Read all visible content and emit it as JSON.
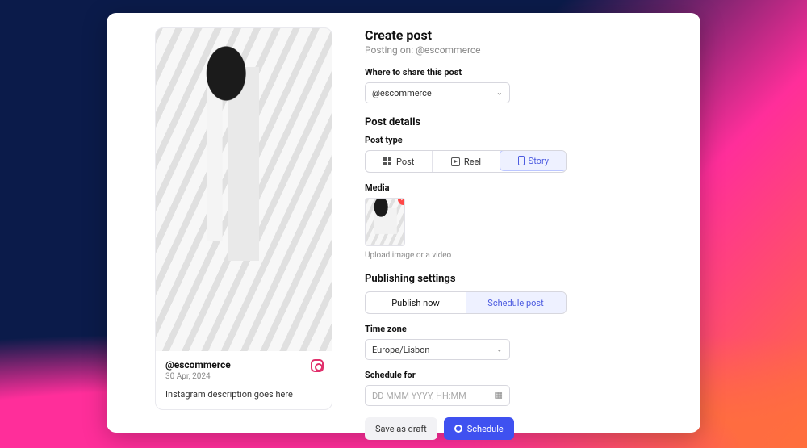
{
  "header": {
    "title": "Create post",
    "posting_on_prefix": "Posting on: ",
    "posting_on_handle": "@escommerce"
  },
  "share": {
    "label": "Where to share this post",
    "selected": "@escommerce"
  },
  "post_details": {
    "section": "Post details",
    "type_label": "Post type",
    "types": {
      "post": "Post",
      "reel": "Reel",
      "story": "Story"
    },
    "active_type": "story",
    "media_label": "Media",
    "media_hint": "Upload image or a video"
  },
  "publishing": {
    "section": "Publishing settings",
    "publish_now": "Publish now",
    "schedule_post": "Schedule post",
    "active_tab": "schedule_post",
    "timezone_label": "Time zone",
    "timezone_value": "Europe/Lisbon",
    "schedule_for_label": "Schedule for",
    "schedule_placeholder": "DD MMM YYYY, HH:MM"
  },
  "footer": {
    "save_draft": "Save as draft",
    "schedule": "Schedule"
  },
  "preview": {
    "author": "@escommerce",
    "date": "30 Apr, 2024",
    "caption": "Instagram description goes here"
  }
}
